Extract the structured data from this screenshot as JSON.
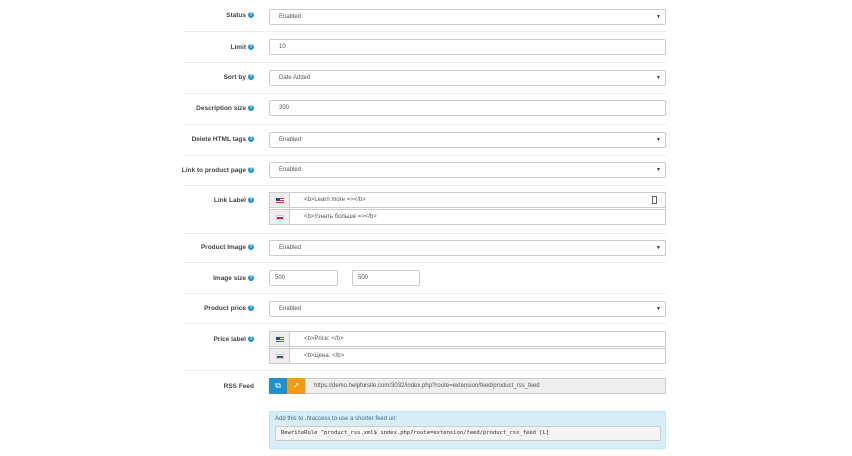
{
  "fields": {
    "status": {
      "label": "Status",
      "value": "Enabled"
    },
    "limit": {
      "label": "Limit",
      "value": "10"
    },
    "sort_by": {
      "label": "Sort by",
      "value": "Date Added"
    },
    "description_size": {
      "label": "Description size",
      "value": "300"
    },
    "delete_html": {
      "label": "Delete HTML tags",
      "value": "Enabled"
    },
    "link_to_product": {
      "label": "Link to product page",
      "value": "Enabled"
    },
    "link_label": {
      "label": "Link Label",
      "en": "<b>Learn more =></b>",
      "ru": "<b>Узнать больше =></b>"
    },
    "product_image": {
      "label": "Product Image",
      "value": "Enabled"
    },
    "image_size": {
      "label": "Image size",
      "width": "500",
      "height": "500"
    },
    "product_price": {
      "label": "Product price",
      "value": "Enabled"
    },
    "price_label": {
      "label": "Price label",
      "en": "<b>Price: </b>",
      "ru": "<b>Цена: </b>"
    },
    "rss_feed": {
      "label": "RSS Feed",
      "url": "https://demo.helpforsite.com/3032/index.php?route=extension/feed/product_rss_feed"
    }
  },
  "htaccess": {
    "note": "Add this to .htaccess to use a shorter feed url:",
    "code": "RewriteRule ^product_rss.xml$ index.php?route=extension/feed/product_rss_feed [L]"
  },
  "icons": {
    "help": "?",
    "copy": "⧉",
    "external": "↗",
    "arrow": "▼"
  },
  "colors": {
    "primary": "#1e91cf",
    "warning": "#f39c12",
    "info_bg": "#d9edf7"
  }
}
